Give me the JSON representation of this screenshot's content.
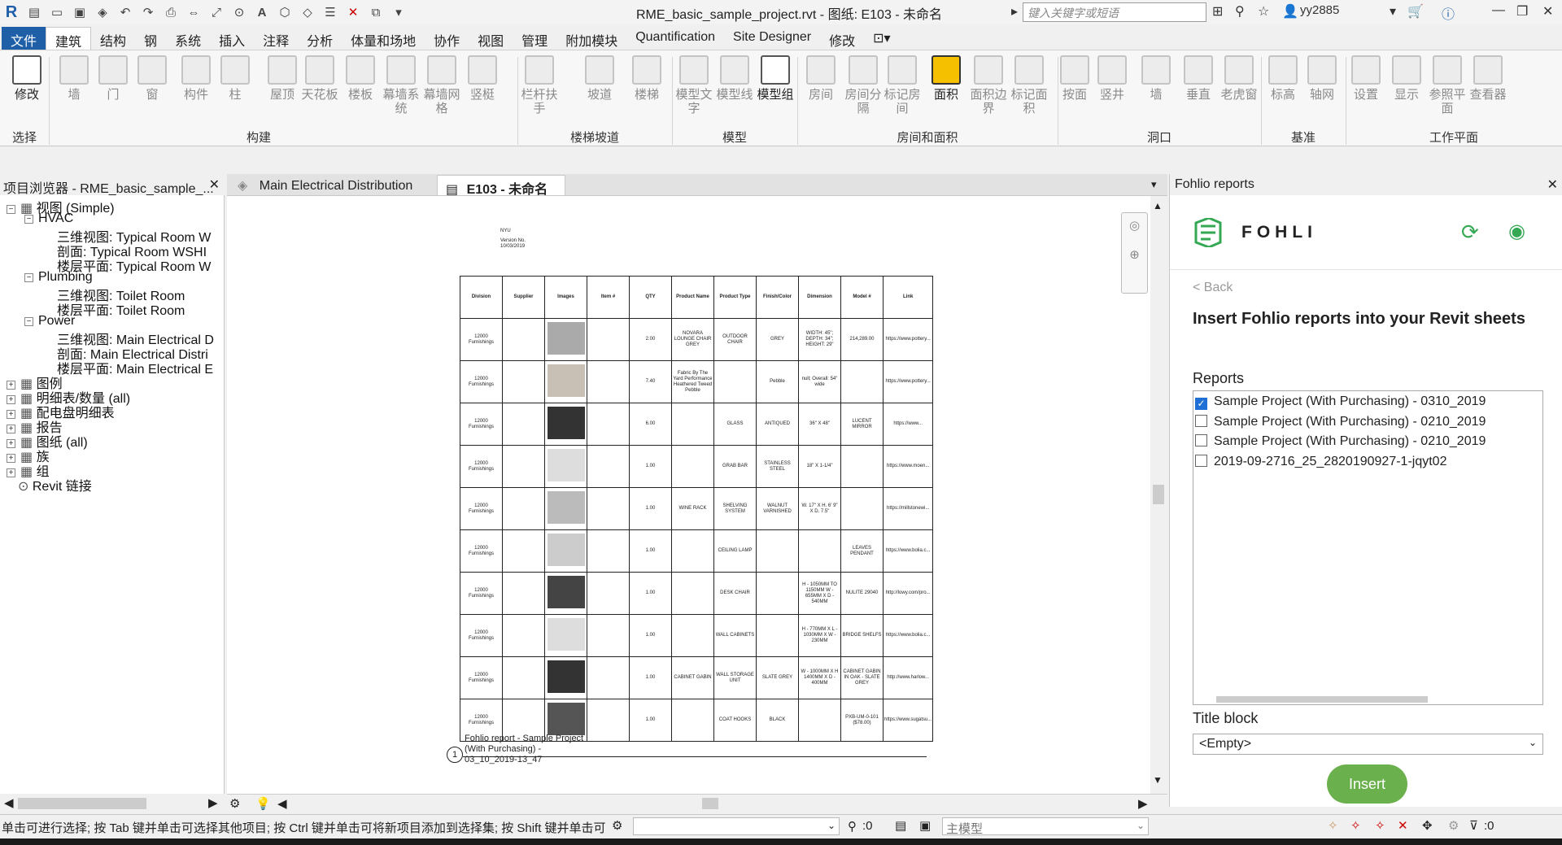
{
  "title": {
    "text": "RME_basic_sample_project.rvt - 图纸: E103 - 未命名",
    "search_placeholder": "键入关键字或短语",
    "user": "yy2885"
  },
  "ribbon_tabs": [
    "文件",
    "建筑",
    "结构",
    "钢",
    "系统",
    "插入",
    "注释",
    "分析",
    "体量和场地",
    "协作",
    "视图",
    "管理",
    "附加模块",
    "Quantification",
    "Site Designer",
    "修改"
  ],
  "ribbon_buttons": [
    "修改",
    "墙",
    "门",
    "窗",
    "构件",
    "柱",
    "屋顶",
    "天花板",
    "楼板",
    "幕墙系统",
    "幕墙网格",
    "竖梃",
    "栏杆扶手",
    "坡道",
    "楼梯",
    "模型文字",
    "模型线",
    "模型组",
    "房间",
    "房间分隔",
    "标记房间",
    "面积",
    "面积边界",
    "标记面积",
    "按面",
    "竖井",
    "墙",
    "垂直",
    "老虎窗",
    "标高",
    "轴网",
    "设置",
    "显示",
    "参照平面",
    "查看器"
  ],
  "ribbon_groups": [
    "选择",
    "构建",
    "楼梯坡道",
    "模型",
    "房间和面积",
    "洞口",
    "基准",
    "工作平面"
  ],
  "browser": {
    "title": "项目浏览器 - RME_basic_sample_...",
    "items": [
      "视图 (Simple)",
      "HVAC",
      "三维视图: Typical Room W",
      "剖面: Typical Room WSHI",
      "楼层平面: Typical Room W",
      "Plumbing",
      "三维视图: Toilet Room",
      "楼层平面: Toilet Room",
      "Power",
      "三维视图: Main Electrical D",
      "剖面: Main Electrical Distri",
      "楼层平面: Main Electrical E",
      "图例",
      "明细表/数量 (all)",
      "配电盘明细表",
      "报告",
      "图纸 (all)",
      "族",
      "组",
      "Revit 链接"
    ]
  },
  "view_tabs": [
    "Main Electrical Distribution",
    "E103 - 未命名"
  ],
  "sheet": {
    "header": [
      "NYU",
      "Version No.",
      "10/03/2019"
    ],
    "columns": [
      "Division",
      "Supplier",
      "Images",
      "Item #",
      "QTY",
      "Product Name",
      "Product Type",
      "Finish/Color",
      "Dimension",
      "Model #",
      "Link"
    ],
    "rows": [
      [
        "12000 Furnishings",
        "",
        "",
        "",
        "2.00",
        "NOVARA LOUNGE CHAIR GREY",
        "OUTDOOR CHAIR",
        "GREY",
        "WIDTH: 45\"; DEPTH: 34\"; HEIGHT: 29\"",
        "214,289.00",
        "https://www.pottery..."
      ],
      [
        "12000 Furnishings",
        "",
        "",
        "",
        "7.40",
        "Fabric By The Yard Performance Heathered Tweed Pebble",
        "",
        "Pebble",
        "null; Overall: 54\" wide",
        "",
        "https://www.pottery..."
      ],
      [
        "12000 Furnishings",
        "",
        "",
        "",
        "6.00",
        "",
        "GLASS",
        "ANTIQUED",
        "36\" X 48\"",
        "LUCENT MIRROR",
        "https://www..."
      ],
      [
        "12000 Furnishings",
        "",
        "",
        "",
        "1.00",
        "",
        "GRAB BAR",
        "STAINLESS STEEL",
        "18\" X 1-1/4\"",
        "",
        "https://www.moen..."
      ],
      [
        "12000 Furnishings",
        "",
        "",
        "",
        "1.00",
        "WINE RACK",
        "SHELVING SYSTEM",
        "WALNUT VARNISHED",
        "W. 17\" X H. 6' 9\" X D. 7.5\"",
        "",
        "https://millstonewi..."
      ],
      [
        "12000 Furnishings",
        "",
        "",
        "",
        "1.00",
        "",
        "CEILING LAMP",
        "",
        "",
        "LEAVES PENDANT",
        "https://www.bolia.c..."
      ],
      [
        "12000 Furnishings",
        "",
        "",
        "",
        "1.00",
        "",
        "DESK CHAIR",
        "",
        "H - 1050MM TO 1150MM W - 655MM X D - 540MM",
        "NULITE 29040",
        "http://lowy.com/pro..."
      ],
      [
        "12000 Furnishings",
        "",
        "",
        "",
        "1.00",
        "",
        "WALL CABINETS",
        "",
        "H - 770MM X L - 1030MM X W - 230MM",
        "BRIDGE SHELFS",
        "https://www.bolia.c..."
      ],
      [
        "12000 Furnishings",
        "",
        "",
        "",
        "1.00",
        "CABINET GABIN",
        "WALL STORAGE UNIT",
        "SLATE GREY",
        "W - 1000MM X H 1400MM X D - 400MM",
        "CABINET GABIN IN OAK - SLATE GREY",
        "http://www.harlow..."
      ],
      [
        "12000 Furnishings",
        "",
        "",
        "",
        "1.00",
        "",
        "COAT HOOKS",
        "BLACK",
        "",
        "PXB-UM-0-101 ($78.00)",
        "https://www.sugatsu..."
      ]
    ],
    "footer_label": "Fohlio report - Sample Project (With Purchasing) - 03_10_2019-13_47",
    "footer_number": "1"
  },
  "fohlio": {
    "panel_title": "Fohlio reports",
    "logo_text": "FOHLIO",
    "back": "< Back",
    "heading": "Insert Fohlio reports into your Revit sheets",
    "reports_label": "Reports",
    "reports": [
      {
        "name": "Sample Project (With Purchasing) - 0310_2019",
        "checked": true
      },
      {
        "name": "Sample Project (With Purchasing) - 0210_2019",
        "checked": false
      },
      {
        "name": "Sample Project (With Purchasing) - 0210_2019",
        "checked": false
      },
      {
        "name": "2019-09-2716_25_2820190927-1-jqyt02",
        "checked": false
      }
    ],
    "title_block_label": "Title block",
    "title_block_value": "<Empty>",
    "insert": "Insert"
  },
  "status": {
    "text": "单击可进行选择; 按 Tab 键并单击可选择其他项目; 按 Ctrl 键并单击可将新项目添加到选择集; 按 Shift 键并单击可",
    "zero": ":0",
    "model": "主模型",
    "filter": ":0"
  }
}
